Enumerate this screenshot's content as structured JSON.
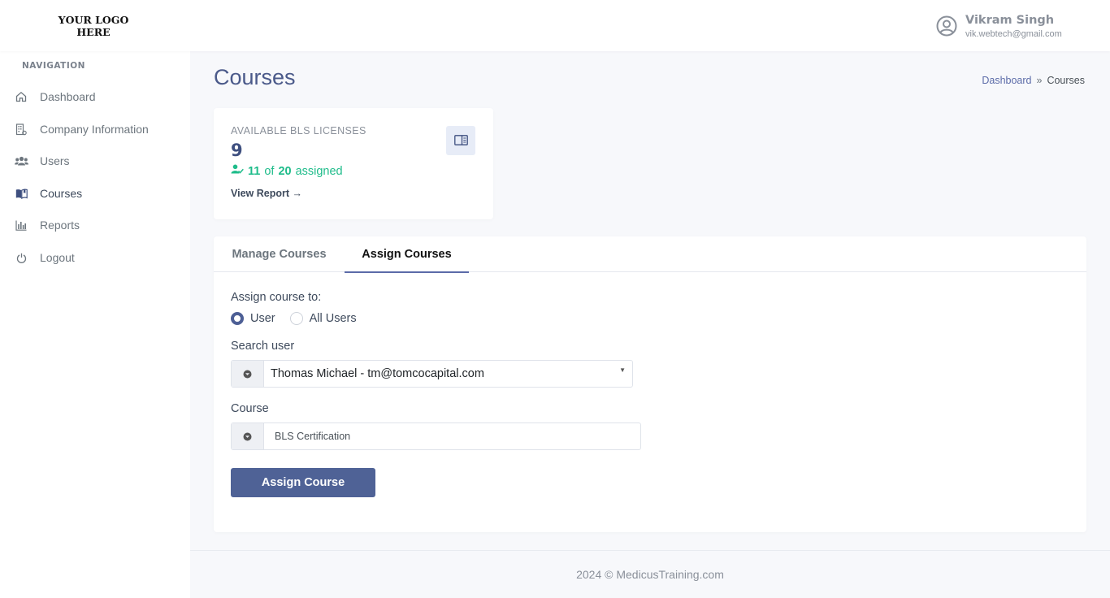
{
  "header": {
    "logo_line1": "YOUR LOGO",
    "logo_line2": "HERE",
    "user_name": "Vikram Singh",
    "user_email": "vik.webtech@gmail.com"
  },
  "sidebar": {
    "title": "NAVIGATION",
    "items": [
      {
        "label": "Dashboard",
        "icon": "home-icon"
      },
      {
        "label": "Company Information",
        "icon": "building-icon"
      },
      {
        "label": "Users",
        "icon": "users-icon"
      },
      {
        "label": "Courses",
        "icon": "book-icon"
      },
      {
        "label": "Reports",
        "icon": "bar-chart-icon"
      },
      {
        "label": "Logout",
        "icon": "power-icon"
      }
    ]
  },
  "page": {
    "title": "Courses",
    "breadcrumb": {
      "parent": "Dashboard",
      "separator": "»",
      "current": "Courses"
    }
  },
  "licenses": {
    "label": "AVAILABLE BLS LICENSES",
    "available": "9",
    "assigned": "11",
    "of_word": "of",
    "total": "20",
    "assigned_word": "assigned",
    "view_report": "View Report →"
  },
  "tabs": {
    "manage": "Manage Courses",
    "assign": "Assign Courses"
  },
  "form": {
    "assign_to_label": "Assign course to:",
    "radio_user": "User",
    "radio_all": "All Users",
    "selected_radio": "User",
    "search_user_label": "Search user",
    "search_user_value": "Thomas Michael - tm@tomcocapital.com",
    "course_label": "Course",
    "course_value": "BLS Certification",
    "submit_label": "Assign Course"
  },
  "footer": {
    "text": "2024 © MedicusTraining.com"
  },
  "colors": {
    "accent": "#4f6296",
    "success": "#1ebc8a",
    "title": "#4b5a8a"
  }
}
